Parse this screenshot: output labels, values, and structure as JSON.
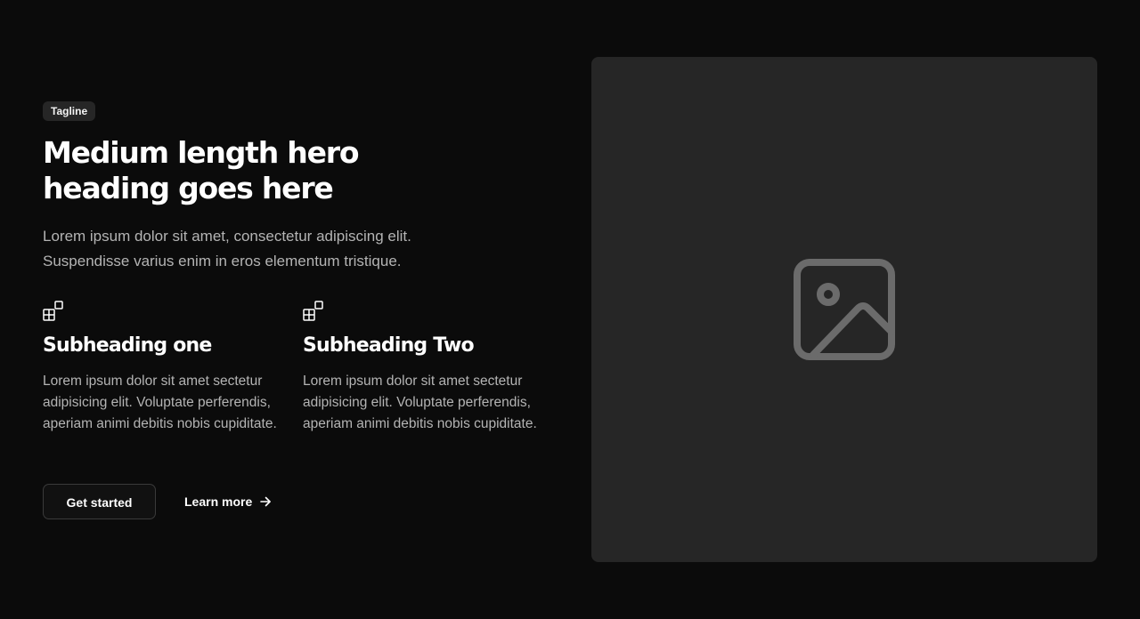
{
  "hero": {
    "tagline": "Tagline",
    "heading": "Medium length hero heading goes here",
    "description": "Lorem ipsum dolor sit amet, consectetur adipiscing elit. Suspendisse varius enim in eros elementum tristique.",
    "features": [
      {
        "icon": "apps-icon",
        "title": "Subheading one",
        "text": "Lorem ipsum dolor sit amet sectetur adipisicing elit. Voluptate perferendis, aperiam animi debitis nobis cupiditate."
      },
      {
        "icon": "apps-icon",
        "title": "Subheading Two",
        "text": "Lorem ipsum dolor sit amet sectetur adipisicing elit. Voluptate perferendis, aperiam animi debitis nobis cupiditate."
      }
    ],
    "primary_button": "Get started",
    "secondary_button": "Learn more",
    "secondary_button_icon": "arrow-right-icon",
    "media_icon": "image-placeholder-icon"
  },
  "colors": {
    "background": "#0b0b0b",
    "tagline_bg": "#262626",
    "media_bg": "#262626",
    "body_text": "#b4b4b4",
    "icon_gray": "#6b6b6b"
  }
}
